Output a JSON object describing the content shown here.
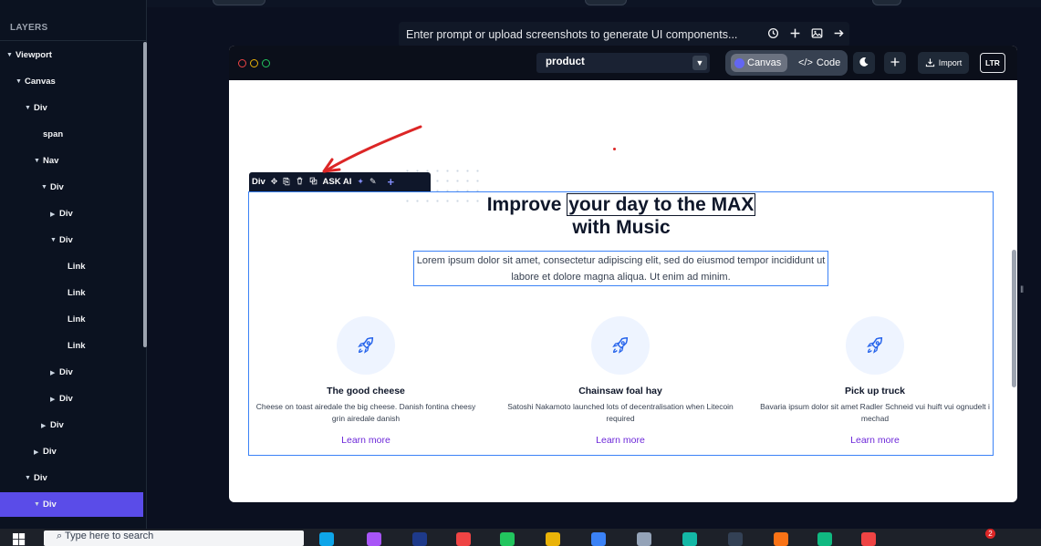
{
  "layers": {
    "title": "LAYERS",
    "items": [
      {
        "label": "Viewport",
        "indent": 0,
        "arrow": "▼",
        "selected": false
      },
      {
        "label": "Canvas",
        "indent": 1,
        "arrow": "▼",
        "selected": false
      },
      {
        "label": "Div",
        "indent": 2,
        "arrow": "▼",
        "selected": false
      },
      {
        "label": "span",
        "indent": 3,
        "arrow": "",
        "selected": false
      },
      {
        "label": "Nav",
        "indent": 3,
        "arrow": "▼",
        "selected": false
      },
      {
        "label": "Div",
        "indent": 4,
        "arrow": "▼",
        "selected": false
      },
      {
        "label": "Div",
        "indent": 5,
        "arrow": "▶",
        "selected": false
      },
      {
        "label": "Div",
        "indent": 5,
        "arrow": "▼",
        "selected": false
      },
      {
        "label": "Link",
        "indent": 6,
        "arrow": "",
        "selected": false
      },
      {
        "label": "Link",
        "indent": 6,
        "arrow": "",
        "selected": false
      },
      {
        "label": "Link",
        "indent": 6,
        "arrow": "",
        "selected": false
      },
      {
        "label": "Link",
        "indent": 6,
        "arrow": "",
        "selected": false
      },
      {
        "label": "Div",
        "indent": 5,
        "arrow": "▶",
        "selected": false
      },
      {
        "label": "Div",
        "indent": 5,
        "arrow": "▶",
        "selected": false
      },
      {
        "label": "Div",
        "indent": 4,
        "arrow": "▶",
        "selected": false
      },
      {
        "label": "Div",
        "indent": 3,
        "arrow": "▶",
        "selected": false
      },
      {
        "label": "Div",
        "indent": 2,
        "arrow": "▼",
        "selected": false
      },
      {
        "label": "Div",
        "indent": 3,
        "arrow": "▼",
        "selected": true
      }
    ]
  },
  "prompt": {
    "text": "Enter prompt or upload screenshots to generate UI components...",
    "icons": [
      "history-icon",
      "plus-icon",
      "image-icon",
      "arrow-right-icon"
    ]
  },
  "preview_bar": {
    "page_select": "product",
    "canvas_label": "Canvas",
    "code_label": "Code",
    "import_label": "Import",
    "direction_label": "LTR"
  },
  "element_toolbar": {
    "element_label": "Div",
    "ask_ai_label": "ASK AI"
  },
  "hero": {
    "title_pre": "Improve ",
    "title_highlight": "your day to the MAX",
    "title_post": "with Music",
    "description": "Lorem ipsum dolor sit amet, consectetur adipiscing elit, sed do eiusmod tempor incididunt ut labore et dolore magna aliqua. Ut enim ad minim."
  },
  "features": [
    {
      "title": "The good cheese",
      "description": "Cheese on toast airedale the big cheese. Danish fontina cheesy grin airedale danish",
      "link": "Learn more",
      "icon": "rocket-icon"
    },
    {
      "title": "Chainsaw foal hay",
      "description": "Satoshi Nakamoto launched lots of decentralisation when Litecoin required",
      "link": "Learn more",
      "icon": "rocket-icon"
    },
    {
      "title": "Pick up truck",
      "description": "Bavaria ipsum dolor sit amet Radler Schneid vui huift vui ognudelt i mechad",
      "link": "Learn more",
      "icon": "rocket-icon"
    }
  ],
  "taskbar": {
    "search_placeholder": "Type here to search",
    "notification_count": "2"
  },
  "colors": {
    "accent": "#5a4ce8",
    "selection": "#3b82f6",
    "link": "#6d28d9",
    "annotation_arrow": "#dc2626"
  }
}
